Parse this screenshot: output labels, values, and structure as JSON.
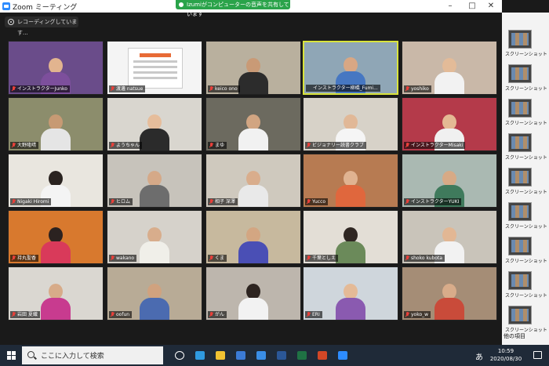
{
  "window": {
    "title": "Zoom ミーティング",
    "share_banner": "Izumiがコンピューターの音声を共有しています",
    "recording": "レコーディングしています...",
    "buttons": {
      "minimize": "–",
      "maximize": "□",
      "close": "✕"
    }
  },
  "participants": [
    {
      "name": "インストラクターJunko",
      "muted": true,
      "scene": "#6a4c8a",
      "head": "#e2b48f",
      "body": "#7d4f9c"
    },
    {
      "name": "渡邊 natsue",
      "muted": true,
      "scene": "#f4f4f4",
      "poster": true
    },
    {
      "name": "keico ono",
      "muted": true,
      "scene": "#b9b09e",
      "head": "#c99a76",
      "body": "#2c2c2c"
    },
    {
      "name": "インストラクター柳橋_Fumi...",
      "muted": false,
      "active": true,
      "scene": "#8fa6b6",
      "head": "#d8a784",
      "body": "#4677c2"
    },
    {
      "name": "yoshiko",
      "muted": true,
      "scene": "#c9b8a8",
      "head": "#e3bb98",
      "body": "#f2f2f2"
    },
    {
      "name": "大野隆晴",
      "muted": true,
      "scene": "#8c8d6c",
      "head": "#c79a74",
      "body": "#e5e5e5"
    },
    {
      "name": "ようちゃん",
      "muted": true,
      "scene": "#d9d6cf",
      "head": "#e6bd9b",
      "body": "#2b2b2b"
    },
    {
      "name": "まゆ",
      "muted": true,
      "scene": "#6c6a5f",
      "head": "#d1a582",
      "body": "#f1f1f1"
    },
    {
      "name": "ビジョナリー読書クラブ",
      "muted": true,
      "scene": "#d7d2c8",
      "head": "#e1b897",
      "body": "#f5f5f5"
    },
    {
      "name": "インストラクターMisaki",
      "muted": true,
      "scene": "#b43a4a",
      "head": "#e4b994",
      "body": "#f0f0f0"
    },
    {
      "name": "Nigaki Hiromi",
      "muted": true,
      "scene": "#e9e6df",
      "head": "#2a2320",
      "body": "#f4f4f4"
    },
    {
      "name": "ヒロム",
      "muted": true,
      "scene": "#c7c3bb",
      "head": "#d5a988",
      "body": "#6d6d6d"
    },
    {
      "name": "相子 深澤",
      "muted": true,
      "scene": "#cfc9be",
      "head": "#d9ad8c",
      "body": "#e9e9e9"
    },
    {
      "name": "Yucco",
      "muted": true,
      "scene": "#b77b52",
      "head": "#e0b391",
      "body": "#e0673d"
    },
    {
      "name": "インストラクターYUKI",
      "muted": true,
      "scene": "#aab9b2",
      "head": "#d7aa86",
      "body": "#3f7a5c"
    },
    {
      "name": "持丸聖香",
      "muted": true,
      "scene": "#d8792e",
      "head": "#2b2220",
      "body": "#d93a5a"
    },
    {
      "name": "wakano",
      "muted": true,
      "scene": "#d6d2cb",
      "head": "#d8ad8c",
      "body": "#f0efe9"
    },
    {
      "name": "くま",
      "muted": true,
      "scene": "#c7b99e",
      "head": "#d3a682",
      "body": "#4a4fb5"
    },
    {
      "name": "千葉としえ",
      "muted": true,
      "scene": "#e3ded6",
      "head": "#2f2622",
      "body": "#6b8a5a"
    },
    {
      "name": "shoko kubota",
      "muted": true,
      "scene": "#c9c4ba",
      "head": "#e2b794",
      "body": "#f2f2f2"
    },
    {
      "name": "岩田 夏織",
      "muted": true,
      "scene": "#dad7d1",
      "head": "#d7ab89",
      "body": "#c83b8f"
    },
    {
      "name": "oofun",
      "muted": true,
      "scene": "#b8ab96",
      "head": "#d0a27f",
      "body": "#4b6bb0"
    },
    {
      "name": "がん",
      "muted": true,
      "scene": "#bdb6ad",
      "head": "#2d2420",
      "body": "#f2f2f2"
    },
    {
      "name": "ERI",
      "muted": true,
      "scene": "#cfd6dc",
      "head": "#e4ba97",
      "body": "#8a5ab0"
    },
    {
      "name": "yoko_w",
      "muted": true,
      "scene": "#a58d76",
      "head": "#d8ac8a",
      "body": "#c94b3a"
    }
  ],
  "desktop": {
    "items": [
      "スクリーンショット",
      "スクリーンショット",
      "スクリーンショット",
      "スクリーンショット",
      "スクリーンショット",
      "スクリーンショット",
      "スクリーンショット",
      "スクリーンショット",
      "スクリーンショット"
    ],
    "bottom_label": "他の項目"
  },
  "taskbar": {
    "search_placeholder": "ここに入力して検索",
    "ime": "あ",
    "time": "10:59",
    "date": "2020/08/30",
    "apps": [
      {
        "name": "task-view",
        "color": "#ffffff"
      },
      {
        "name": "edge",
        "color": "#2f9ae0"
      },
      {
        "name": "explorer",
        "color": "#f1c232"
      },
      {
        "name": "store",
        "color": "#3b7bd6"
      },
      {
        "name": "mail",
        "color": "#3a8ee6"
      },
      {
        "name": "word",
        "color": "#2b5797"
      },
      {
        "name": "excel",
        "color": "#1f7244"
      },
      {
        "name": "powerpoint",
        "color": "#d24726"
      },
      {
        "name": "zoom",
        "color": "#2d8cff"
      }
    ]
  }
}
